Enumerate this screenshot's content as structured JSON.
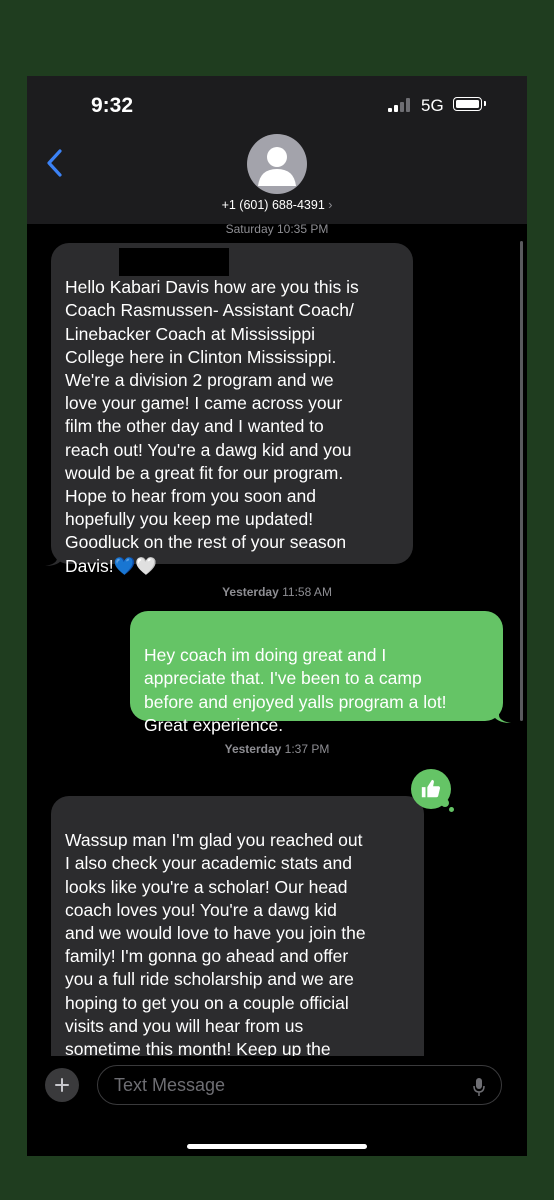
{
  "status_bar": {
    "time": "9:32",
    "network": "5G"
  },
  "header": {
    "phone_number": "+1 (601) 688-4391",
    "chevron": "›"
  },
  "icons": {
    "back": "chevron-left-icon",
    "avatar": "person-icon",
    "reaction": "thumbs-up-icon",
    "plus": "plus-icon",
    "mic": "microphone-icon"
  },
  "colors": {
    "sent_bubble": "#65c466",
    "received_bubble": "#2c2c2e",
    "accent_blue": "#3b82f6",
    "frame_bg": "#1f3d1f"
  },
  "timestamps": {
    "first": "Saturday 10:35 PM",
    "second_day": "Yesterday",
    "second_time": "11:58 AM",
    "third_day": "Yesterday",
    "third_time": "1:37 PM"
  },
  "messages": [
    {
      "direction": "received",
      "text": "Hello Kabari Davis how are you this is\nCoach Rasmussen- Assistant Coach/\nLinebacker Coach at Mississippi\nCollege here in Clinton Mississippi.\nWe're a division 2 program and we\nlove your game! I came across your\nfilm the other day and I wanted to\nreach out! You're a dawg kid and you\nwould be a great fit for our program.\nHope to hear from you soon and\nhopefully you keep me updated!\nGoodluck on the rest of your season\nDavis!💙🤍"
    },
    {
      "direction": "sent",
      "text": "Hey coach im doing great and I\nappreciate that. I've been to a camp\nbefore and enjoyed yalls program a lot!\nGreat experience."
    },
    {
      "direction": "received",
      "text": "Wassup man I'm glad you reached out\nI also check your academic stats and\nlooks like you're a scholar! Our head\ncoach loves you! You're a dawg kid\nand we would love to have you join the\nfamily! I'm gonna go ahead and offer\nyou a full ride scholarship and we are\nhoping to get you on a couple official\nvisits and you will hear from us\nsometime this month! Keep up the\ngreat work kid! You have permission to"
    }
  ],
  "composer": {
    "placeholder": "Text Message"
  }
}
